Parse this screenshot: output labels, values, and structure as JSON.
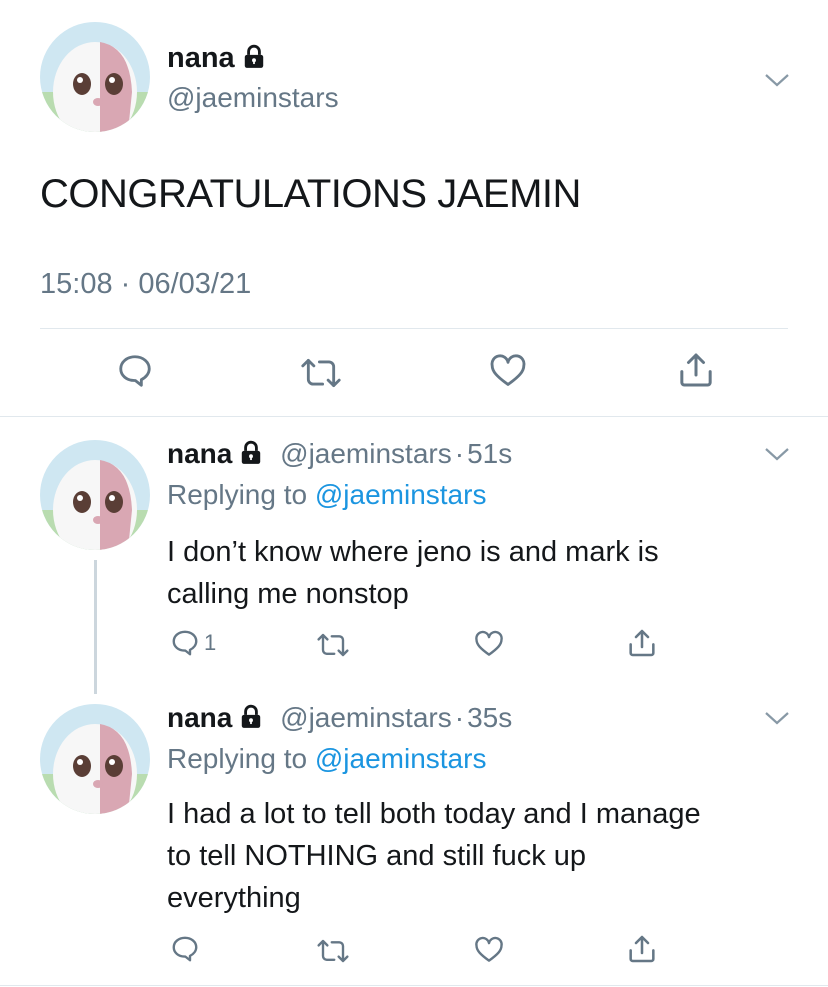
{
  "main_tweet": {
    "display_name": "nana",
    "handle": "@jaeminstars",
    "text": "CONGRATULATIONS JAEMIN",
    "timestamp": "15:08 · 06/03/21"
  },
  "replies": [
    {
      "display_name": "nana",
      "handle": "@jaeminstars",
      "sep": "·",
      "time": "51s",
      "replying_prefix": "Replying to",
      "replying_to": "@jaeminstars",
      "text_line1": "I don’t know where jeno is and mark is",
      "text_line2": "calling me nonstop",
      "reply_count": "1"
    },
    {
      "display_name": "nana",
      "handle": "@jaeminstars",
      "sep": "·",
      "time": "35s",
      "replying_prefix": "Replying to",
      "replying_to": "@jaeminstars",
      "text_line1": "I had a lot to tell both today and I manage",
      "text_line2": "to tell NOTHING and still fuck up",
      "text_line3": "everything",
      "reply_count": ""
    }
  ],
  "icons": {
    "lock": "lock-icon",
    "chevron": "chevron-down-icon",
    "reply": "reply-icon",
    "retweet": "retweet-icon",
    "like": "heart-icon",
    "share": "share-icon"
  },
  "colors": {
    "text": "#14171a",
    "secondary": "#657786",
    "link": "#1b95e0",
    "divider": "#e1e8ed",
    "avatar_pink": "#d9a7b3"
  }
}
